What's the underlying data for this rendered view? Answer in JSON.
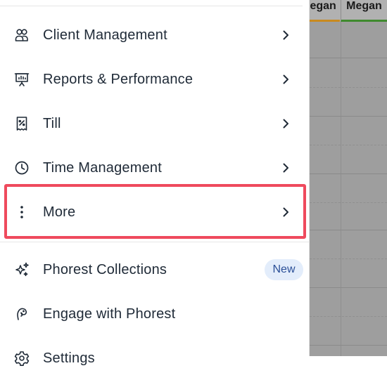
{
  "calendar": {
    "columns": [
      {
        "name": "Megan",
        "color": "#c98a1f"
      },
      {
        "name": "Megan",
        "color": "#3f8a2e"
      }
    ]
  },
  "menu": {
    "items": [
      {
        "label": "Client Management",
        "icon": "client-management-icon",
        "chevron": true
      },
      {
        "label": "Reports & Performance",
        "icon": "reports-icon",
        "chevron": true
      },
      {
        "label": "Till",
        "icon": "till-receipt-icon",
        "chevron": true
      },
      {
        "label": "Time Management",
        "icon": "clock-icon",
        "chevron": true
      },
      {
        "label": "More",
        "icon": "more-vertical-icon",
        "chevron": true,
        "highlighted": true
      },
      {
        "label": "Phorest Collections",
        "icon": "sparkles-icon",
        "badge": "New"
      },
      {
        "label": "Engage with Phorest",
        "icon": "engage-icon"
      },
      {
        "label": "Settings",
        "icon": "settings-icon"
      }
    ]
  },
  "colors": {
    "highlight": "#ef4a5d",
    "badge_bg": "#e3edfb",
    "badge_text": "#2a4f97",
    "text": "#1f2a37"
  }
}
